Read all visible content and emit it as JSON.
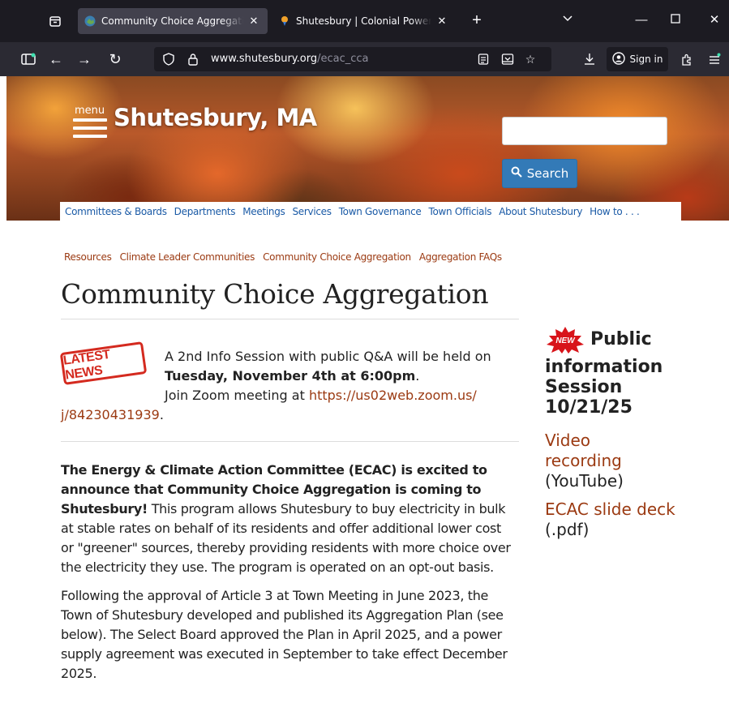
{
  "browser": {
    "tabs": [
      {
        "title": "Community Choice Aggregation",
        "active": true
      },
      {
        "title": "Shutesbury | Colonial Power Group",
        "active": false
      }
    ],
    "url_domain": "www.shutesbury.org",
    "url_path": "/ecac_cca",
    "sign_in_label": "Sign in"
  },
  "site": {
    "menu_label": "menu",
    "title": "Shutesbury, MA",
    "search_placeholder": "",
    "search_button": "Search",
    "nav": [
      "Committees & Boards",
      "Departments",
      "Meetings",
      "Services",
      "Town Governance",
      "Town Officials",
      "About Shutesbury",
      "How to . . ."
    ]
  },
  "subnav": [
    "Resources",
    "Climate Leader Communities",
    "Community Choice Aggregation",
    "Aggregation FAQs"
  ],
  "page_title": "Community Choice Aggregation",
  "news": {
    "stamp": "LATEST NEWS",
    "line1": "A 2nd Info Session with public Q&A will be held on",
    "line2": "Tuesday, November 4th at 6:00pm",
    "line2_end": ".",
    "line3_prefix": "Join Zoom meeting at ",
    "link_part1": "https://us02web.zoom.us/",
    "link_part2": "j/84230431939",
    "line4_end": "."
  },
  "para1": {
    "bold": "The Energy & Climate Action Committee (ECAC) is excited to announce that Community Choice Aggregation is coming to Shutesbury!",
    "rest": "  This program allows Shutesbury to buy electricity in bulk at stable rates on behalf of its residents and offer additional lower cost or \"greener\" sources, thereby providing residents with more choice over the electricity they use.  The program is operated on an opt-out basis."
  },
  "para2": "Following the approval of Article 3 at Town Meeting in June 2023, the Town of Shutesbury developed and published its Aggregation Plan (see below).  The Select Board approved the Plan in April 2025, and a power supply agreement was executed in September to take effect December 2025.",
  "sidebar": {
    "new_badge": "NEW",
    "heading_line1": "Public",
    "heading_rest": "information Session 10/21/25",
    "video_link": "Video recording",
    "video_suffix": "(YouTube)",
    "deck_link": "ECAC slide deck",
    "deck_suffix": "(.pdf)"
  },
  "colors": {
    "link": "#9b3a12",
    "nav_link": "#1a5aa6",
    "search_button": "#337ab7",
    "stamp": "#d42a1f"
  }
}
